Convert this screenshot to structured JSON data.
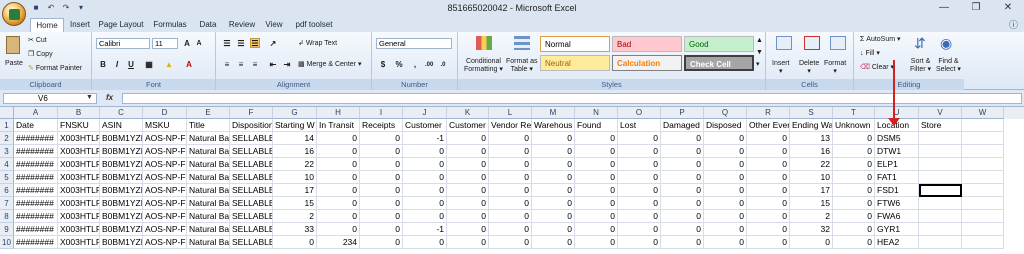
{
  "window": {
    "title": "851665020042 - Microsoft Excel"
  },
  "tabs": [
    "Home",
    "Insert",
    "Page Layout",
    "Formulas",
    "Data",
    "Review",
    "View",
    "pdf toolset"
  ],
  "ribbon": {
    "clipboard": {
      "paste": "Paste",
      "cut": "Cut",
      "copy": "Copy",
      "format_painter": "Format Painter",
      "label": "Clipboard"
    },
    "font": {
      "name": "Calibri",
      "size": "11",
      "label": "Font"
    },
    "alignment": {
      "wrap": "Wrap Text",
      "merge": "Merge & Center",
      "label": "Alignment"
    },
    "number": {
      "format": "General",
      "label": "Number"
    },
    "styles": {
      "conditional": "Conditional",
      "formatting": "Formatting",
      "format_as": "Format as",
      "table": "Table",
      "label": "Styles",
      "normal": "Normal",
      "bad": "Bad",
      "good": "Good",
      "neutral": "Neutral",
      "calculation": "Calculation",
      "check_cell": "Check Cell"
    },
    "cells": {
      "insert": "Insert",
      "delete": "Delete",
      "format": "Format",
      "label": "Cells"
    },
    "editing": {
      "autosum": "AutoSum",
      "fill": "Fill",
      "clear": "Clear",
      "sort1": "Sort &",
      "sort2": "Filter",
      "find1": "Find &",
      "find2": "Select",
      "label": "Editing"
    }
  },
  "formula_bar": {
    "namebox": "V6",
    "fx": "fx",
    "formula": ""
  },
  "columns": [
    "A",
    "B",
    "C",
    "D",
    "E",
    "F",
    "G",
    "H",
    "I",
    "J",
    "K",
    "L",
    "M",
    "N",
    "O",
    "P",
    "Q",
    "R",
    "S",
    "T",
    "U",
    "V",
    "W"
  ],
  "headers": [
    "Date",
    "FNSKU",
    "ASIN",
    "MSKU",
    "Title",
    "Disposition",
    "Starting W",
    "In Transit",
    "Receipts",
    "Customer",
    "Customer",
    "Vendor Re",
    "Warehous",
    "Found",
    "Lost",
    "Damaged",
    "Disposed",
    "Other Even",
    "Ending Wa",
    "Unknown",
    "Location",
    "Store",
    ""
  ],
  "rows": [
    [
      "########",
      "X003HTLR",
      "B0BM1YZF",
      "AOS-NP-FF",
      "Natural Ba",
      "SELLABLE",
      "14",
      "0",
      "0",
      "-1",
      "0",
      "0",
      "0",
      "0",
      "0",
      "0",
      "0",
      "0",
      "13",
      "0",
      "DSM5",
      "",
      ""
    ],
    [
      "########",
      "X003HTLR",
      "B0BM1YZF",
      "AOS-NP-FF",
      "Natural Ba",
      "SELLABLE",
      "16",
      "0",
      "0",
      "0",
      "0",
      "0",
      "0",
      "0",
      "0",
      "0",
      "0",
      "0",
      "16",
      "0",
      "DTW1",
      "",
      ""
    ],
    [
      "########",
      "X003HTLR",
      "B0BM1YZF",
      "AOS-NP-FF",
      "Natural Ba",
      "SELLABLE",
      "22",
      "0",
      "0",
      "0",
      "0",
      "0",
      "0",
      "0",
      "0",
      "0",
      "0",
      "0",
      "22",
      "0",
      "ELP1",
      "",
      ""
    ],
    [
      "########",
      "X003HTLR",
      "B0BM1YZF",
      "AOS-NP-FF",
      "Natural Ba",
      "SELLABLE",
      "10",
      "0",
      "0",
      "0",
      "0",
      "0",
      "0",
      "0",
      "0",
      "0",
      "0",
      "0",
      "10",
      "0",
      "FAT1",
      "",
      ""
    ],
    [
      "########",
      "X003HTLR",
      "B0BM1YZF",
      "AOS-NP-FF",
      "Natural Ba",
      "SELLABLE",
      "17",
      "0",
      "0",
      "0",
      "0",
      "0",
      "0",
      "0",
      "0",
      "0",
      "0",
      "0",
      "17",
      "0",
      "FSD1",
      "",
      ""
    ],
    [
      "########",
      "X003HTLR",
      "B0BM1YZF",
      "AOS-NP-FF",
      "Natural Ba",
      "SELLABLE",
      "15",
      "0",
      "0",
      "0",
      "0",
      "0",
      "0",
      "0",
      "0",
      "0",
      "0",
      "0",
      "15",
      "0",
      "FTW6",
      "",
      ""
    ],
    [
      "########",
      "X003HTLR",
      "B0BM1YZF",
      "AOS-NP-FF",
      "Natural Ba",
      "SELLABLE",
      "2",
      "0",
      "0",
      "0",
      "0",
      "0",
      "0",
      "0",
      "0",
      "0",
      "0",
      "0",
      "2",
      "0",
      "FWA6",
      "",
      ""
    ],
    [
      "########",
      "X003HTLR",
      "B0BM1YZF",
      "AOS-NP-FF",
      "Natural Ba",
      "SELLABLE",
      "33",
      "0",
      "0",
      "-1",
      "0",
      "0",
      "0",
      "0",
      "0",
      "0",
      "0",
      "0",
      "32",
      "0",
      "GYR1",
      "",
      ""
    ],
    [
      "########",
      "X003HTLR",
      "B0BM1YZF",
      "AOS-NP-FF",
      "Natural Ba",
      "SELLABLE",
      "0",
      "234",
      "0",
      "0",
      "0",
      "0",
      "0",
      "0",
      "0",
      "0",
      "0",
      "0",
      "0",
      "0",
      "HEA2",
      "",
      ""
    ]
  ],
  "colors": {
    "accent": "#d42020",
    "ribbon": "#dbe5f1",
    "bad": "#ffc7ce",
    "good": "#c6efce",
    "neutral": "#ffeb9c",
    "check": "#a5a5a5"
  }
}
